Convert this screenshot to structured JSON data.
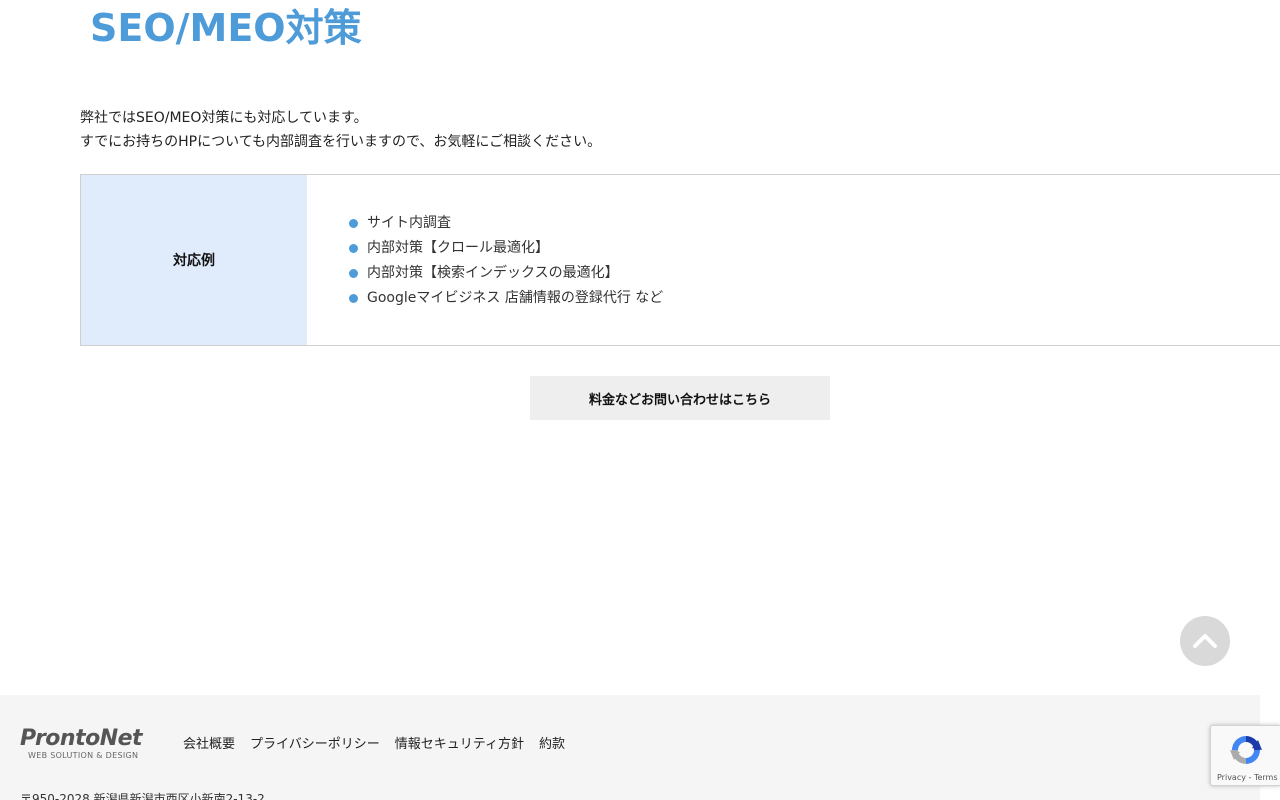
{
  "section": {
    "title": "SEO/MEO対策"
  },
  "intro": {
    "line1": "弊社ではSEO/MEO対策にも対応しています。",
    "line2": "すでにお持ちのHPについても内部調査を行いますので、お気軽にご相談ください。"
  },
  "table": {
    "header": "対応例",
    "items": [
      "サイト内調査",
      "内部対策【クロール最適化】",
      "内部対策【検索インデックスの最適化】",
      "Googleマイビジネス 店舗情報の登録代行 など"
    ]
  },
  "contact_button": {
    "label": "料金などお問い合わせはこちら"
  },
  "footer": {
    "logo": {
      "name": "ProntoNet",
      "tagline": "WEB SOLUTION & DESIGN"
    },
    "nav": [
      "会社概要",
      "プライバシーポリシー",
      "情報セキュリティ方針",
      "約款"
    ],
    "address": "〒950-2028 新潟県新潟市西区小新南2-13-2"
  },
  "recaptcha": {
    "privacy": "Privacy",
    "separator": " - ",
    "terms": "Terms"
  },
  "icons": {
    "back_to_top": "chevron-up-icon",
    "recaptcha": "recaptcha-icon",
    "bullet": "circle-bullet-icon"
  },
  "colors": {
    "accent": "#4d9bd8",
    "table_header_bg": "#e0ebfb",
    "button_bg": "#eeeeee",
    "footer_bg": "#f5f5f5"
  }
}
